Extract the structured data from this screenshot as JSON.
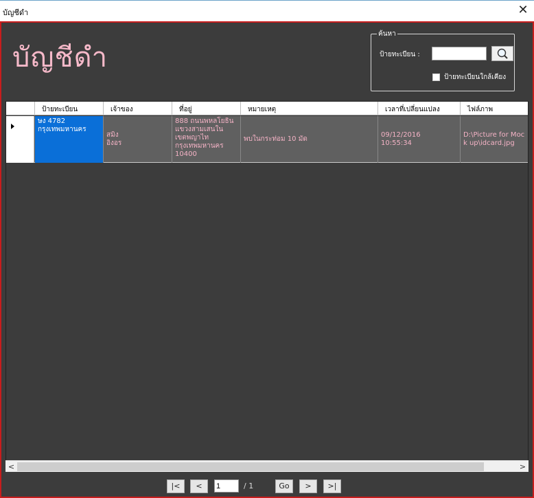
{
  "window": {
    "title": "บัญชีดำ",
    "close_glyph": "✕"
  },
  "page": {
    "heading": "บัญชีดำ"
  },
  "search": {
    "legend": "ค้นหา",
    "plate_label": "ป้ายทะเบียน :",
    "plate_value": "",
    "nearby_label": "ป้ายทะเบียนใกล้เคียง",
    "nearby_checked": false
  },
  "table": {
    "columns": [
      "ป้ายทะเบียน",
      "เจ้าของ",
      "ที่อยู่",
      "หมายเหตุ",
      "เวลาที่เปลี่ยนแปลง",
      "ไฟล์ภาพ"
    ],
    "rows": [
      {
        "plate": "ษง 4782\nกรุงเทพมหานคร",
        "owner": "สมิง\nอิงอร",
        "address": "888 ถนนพหลโยธิน\nแขวงสามเสนใน\nเขตพญาไท\nกรุงเทพมหานคร\n10400",
        "note": "พบในกระท่อม 10 มัด",
        "changed": "09/12/2016\n10:55:34",
        "image": "D:\\Picture for Mock up\\idcard.jpg"
      }
    ]
  },
  "pager": {
    "first": "|<",
    "prev": "<",
    "page": "1",
    "total": "/ 1",
    "go": "Go",
    "next": ">",
    "last": ">|"
  },
  "scroll": {
    "left": "<",
    "right": ">"
  },
  "colors": {
    "accent_pink": "#f6b9c9",
    "border_red": "#c81d1d",
    "selection_blue": "#0a6fd8"
  },
  "icons": {
    "search": "magnifier-icon",
    "close": "close-icon",
    "row-pointer": "triangle-right-icon"
  }
}
